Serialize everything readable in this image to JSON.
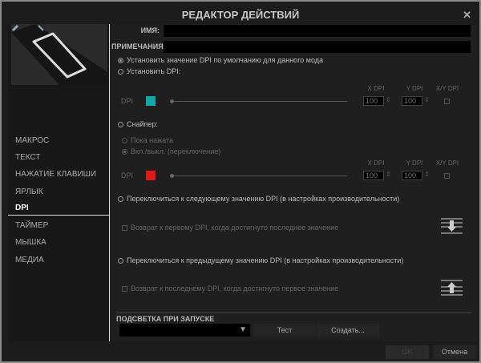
{
  "title": "РЕДАКТОР ДЕЙСТВИЙ",
  "fields": {
    "name_label": "ИМЯ:",
    "name_value": "",
    "notes_label": "ПРИМЕЧАНИЯ:",
    "notes_value": ""
  },
  "nav": [
    {
      "label": "МАКРОС"
    },
    {
      "label": "ТЕКСТ"
    },
    {
      "label": "НАЖАТИЕ КЛАВИШИ"
    },
    {
      "label": "ЯРЛЫК"
    },
    {
      "label": "DPI",
      "selected": true
    },
    {
      "label": "ТАЙМЕР"
    },
    {
      "label": "МЫШКА"
    },
    {
      "label": "МЕДИА"
    }
  ],
  "options": {
    "default_dpi": "Установить значение DPI по умолчанию для данного мода",
    "set_dpi": "Установить DPI:",
    "sniper": "Снайпер:",
    "while_pressed": "Пока нажата",
    "toggle": "Вкл./выкл. (переключение)",
    "next_dpi": "Переключиться к следующему значению DPI (в настройках производительности)",
    "wrap_first": "Возврат к первому DPI, когда достигнуто последнее значение",
    "prev_dpi": "Переключиться к предыдущему значению DPI (в настройках производительности)",
    "wrap_last": "Возврат к последнему DPI, когда достигнуто первое значение"
  },
  "dpi_rows": [
    {
      "label": "DPI",
      "color": "#13a8a8",
      "x_header": "X DPI",
      "y_header": "Y DPI",
      "xy_header": "X/Y DPI",
      "x": "100",
      "y": "100"
    },
    {
      "label": "DPI",
      "color": "#e01818",
      "x_header": "X DPI",
      "y_header": "Y DPI",
      "xy_header": "X/Y DPI",
      "x": "100",
      "y": "100"
    }
  ],
  "lighting": {
    "label": "ПОДСВЕТКА ПРИ ЗАПУСКЕ",
    "test": "Тест",
    "create": "Создать..."
  },
  "footer": {
    "ok": "OK",
    "cancel": "Отмена"
  }
}
